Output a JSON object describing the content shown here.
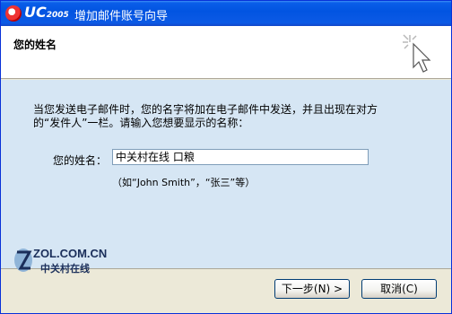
{
  "titlebar": {
    "app_name": "UC",
    "app_version": "2005",
    "title": "增加邮件账号向导"
  },
  "header": {
    "title": "您的姓名"
  },
  "content": {
    "description": "当您发送电子邮件时，您的名字将加在电子邮件中发送，并且出现在对方的“发件人”一栏。请输入您想要显示的名称：",
    "name_label": "您的姓名：",
    "name_value": "中关村在线 口粮",
    "example": "（如“John Smith”，“张三”等）"
  },
  "brand": {
    "main": "ZOL.COM.CN",
    "sub": "中关村在线"
  },
  "buttons": {
    "next": "下一步(N) >",
    "cancel": "取消(C)"
  },
  "colors": {
    "titlebar": "#0254e1",
    "content_bg": "#d6e6f4",
    "window_bg": "#ece9d8"
  }
}
